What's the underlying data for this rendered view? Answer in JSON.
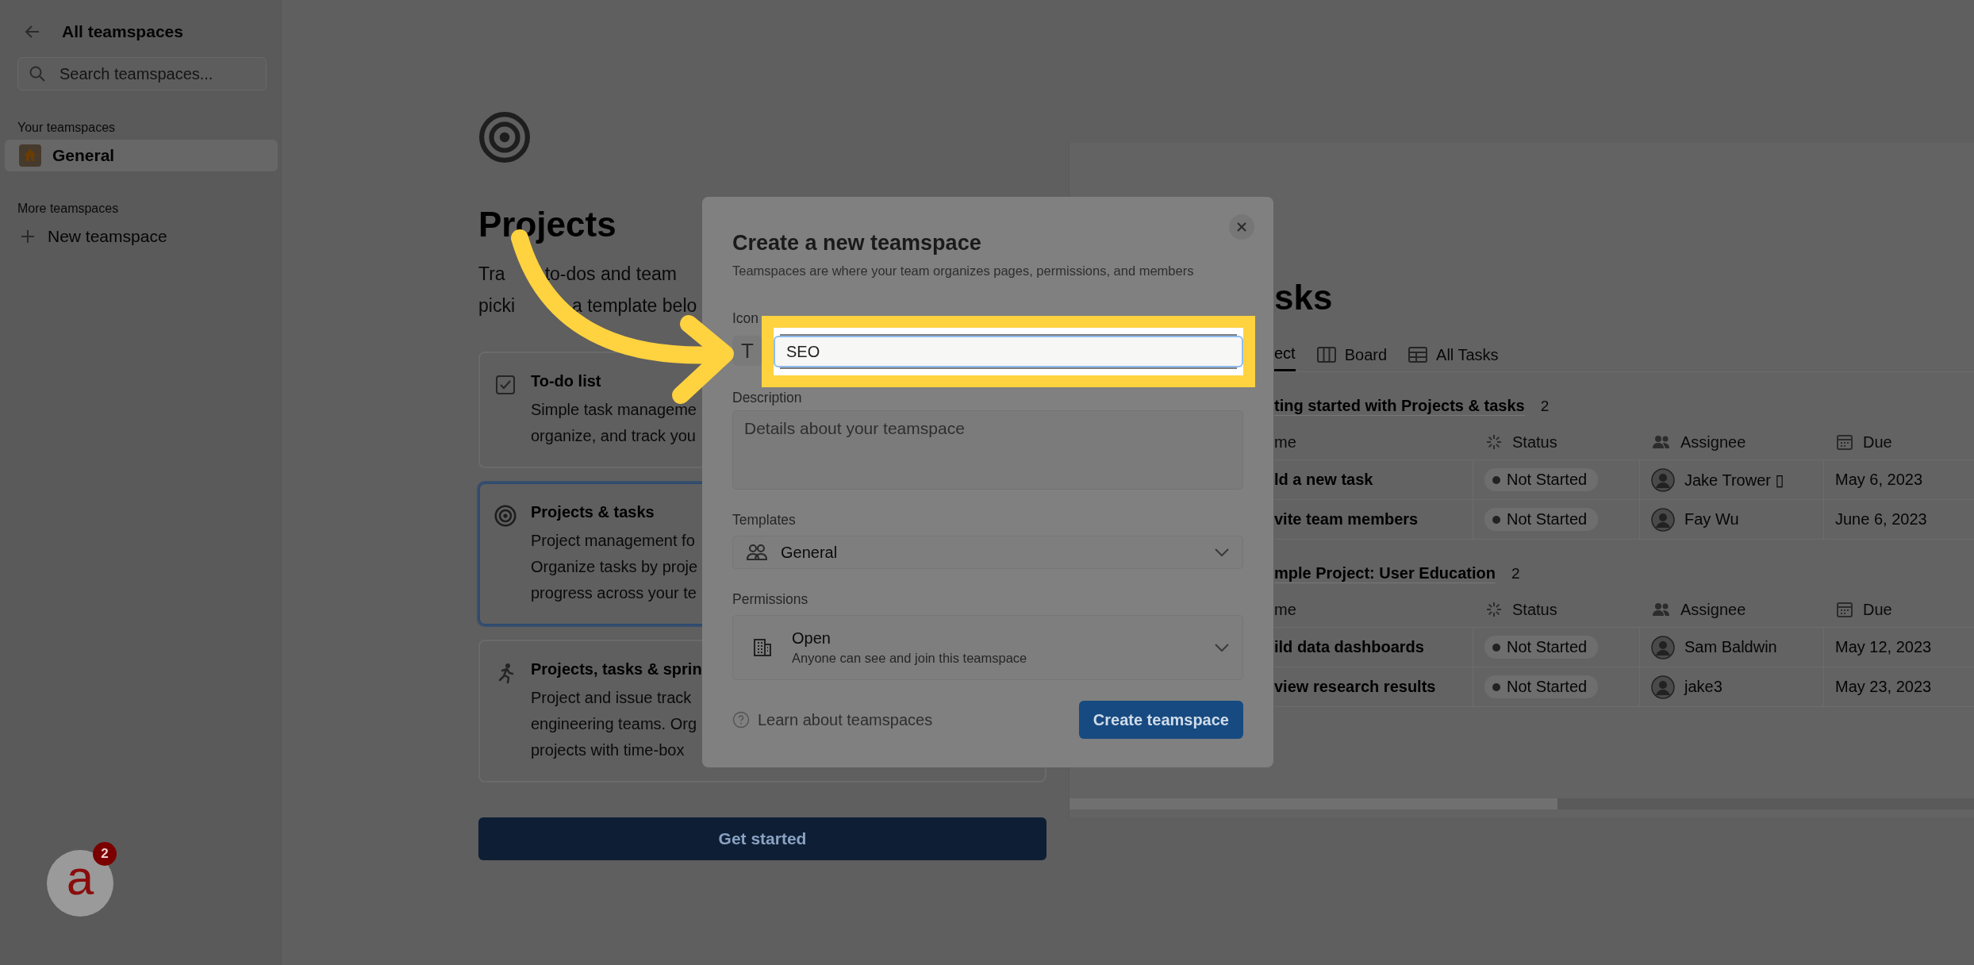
{
  "sidebar": {
    "back_label": "All teamspaces",
    "search": {
      "placeholder": "Search teamspaces..."
    },
    "sections": [
      {
        "title": "Your teamspaces",
        "items": [
          {
            "label": "General",
            "kind": "teamspace",
            "selected": true
          }
        ]
      },
      {
        "title": "More teamspaces",
        "items": [
          {
            "label": "New teamspace",
            "kind": "add",
            "selected": false
          }
        ]
      }
    ]
  },
  "template_page": {
    "title": "Projects",
    "description": [
      {
        "parts": [
          "Tra",
          "to-dos and team"
        ]
      },
      {
        "parts": [
          "picki",
          "a template belo"
        ]
      }
    ],
    "templates": [
      {
        "kind": "checklist",
        "title": "To-do list",
        "lines": [
          "Simple task manageme",
          "organize, and track you"
        ],
        "selected": false
      },
      {
        "kind": "target",
        "title": "Projects & tasks",
        "lines": [
          "Project management fo",
          "Organize tasks by proje",
          "progress across your te"
        ],
        "selected": true
      },
      {
        "kind": "runner",
        "title": "Projects, tasks & sprin",
        "lines": [
          "Project and issue track",
          "engineering teams. Org",
          "projects with time-box"
        ],
        "selected": false
      }
    ],
    "button": "Get started"
  },
  "preview": {
    "title": "sks",
    "tabs": [
      {
        "label": "ect",
        "selected": true
      },
      {
        "label": "Board",
        "kind": "board",
        "selected": false
      },
      {
        "label": "All Tasks",
        "kind": "table",
        "selected": false
      }
    ],
    "groups": [
      {
        "title": "ting started with Projects & tasks",
        "count": "2",
        "columns": [
          "me",
          "Status",
          "Assignee",
          "Due"
        ],
        "rows": [
          {
            "name": "ld a new task",
            "status": "Not Started",
            "assignee": "Jake Trower ▯",
            "due": "May 6, 2023"
          },
          {
            "name": "vite team members",
            "status": "Not Started",
            "assignee": "Fay Wu",
            "due": "June 6, 2023"
          }
        ]
      },
      {
        "title": "mple Project: User Education",
        "count": "2",
        "columns": [
          "me",
          "Status",
          "Assignee",
          "Due"
        ],
        "rows": [
          {
            "name": "ild data dashboards",
            "status": "Not Started",
            "assignee": "Sam Baldwin",
            "due": "May 12, 2023"
          },
          {
            "name": "view research results",
            "status": "Not Started",
            "assignee": "jake3",
            "due": "May 23, 2023"
          }
        ]
      }
    ]
  },
  "modal": {
    "title": "Create a new teamspace",
    "subtitle": "Teamspaces are where your team organizes pages, permissions, and members",
    "icon_label": "Icon",
    "icon_glyph": "T",
    "name": {
      "value": "SEO",
      "focused": true
    },
    "description": {
      "label": "Description",
      "placeholder": "Details about your teamspace"
    },
    "templates": {
      "label": "Templates",
      "value": "General"
    },
    "permissions": {
      "label": "Permissions",
      "value": "Open",
      "detail": "Anyone can see and join this teamspace"
    },
    "help_link": "Learn about teamspaces",
    "submit": "Create teamspace"
  },
  "help_bubble": {
    "glyph": "a",
    "badge": "2"
  }
}
